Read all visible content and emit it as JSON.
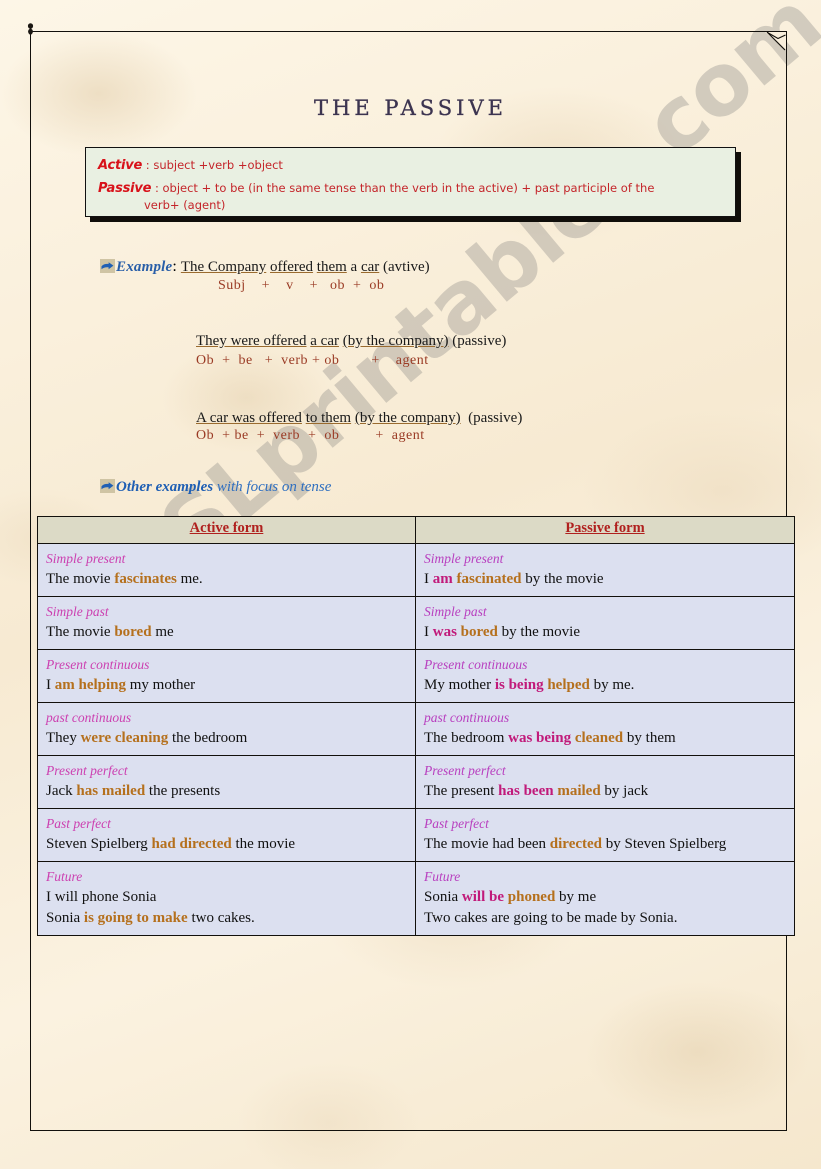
{
  "document": {
    "title": "THE  PASSIVE",
    "watermark": "ESLprintables.com"
  },
  "definition_box": {
    "active_key": "Active",
    "active_sep": " : ",
    "active_text": "subject +verb +object",
    "passive_key": "Passive",
    "passive_sep": " : ",
    "passive_text": "object + to be (in the same tense than the verb in the active) + past participle  of the",
    "passive_text_cont": "verb+ (agent)",
    "bg_color": "#e9f0e2",
    "text_color": "#c4252a",
    "key_color": "#d8121a"
  },
  "example_section": {
    "icon": "pointing-hand-icon",
    "label": "Example",
    "label_sep": ": ",
    "groups": [
      {
        "sentence": "The Company offered them a car (avtive)",
        "sentence_parts": [
          {
            "text": "The Company",
            "underline": true
          },
          {
            "text": " ",
            "underline": false
          },
          {
            "text": "offered",
            "underline": true
          },
          {
            "text": " ",
            "underline": false
          },
          {
            "text": "them",
            "underline": true
          },
          {
            "text": " a ",
            "underline": false
          },
          {
            "text": "car",
            "underline": true
          },
          {
            "text": " (avtive)",
            "underline": false
          }
        ],
        "parse": "Subj    +    v    +   ob  +  ob"
      },
      {
        "sentence": "They were offered a car (by the company) (passive)",
        "parse": "Ob  +  be   +  verb + ob        +    agent"
      },
      {
        "sentence": "A car was offered to them (by the company)   (passive)",
        "parse": "Ob  + be  +  verb  +  ob          +  agent"
      }
    ]
  },
  "other_examples_heading": {
    "icon": "pointing-hand-icon",
    "strong": "Other examples",
    "light": " with focus on tense"
  },
  "table": {
    "headers": [
      "Active form",
      "Passive form"
    ],
    "header_bg": "#dcdac6",
    "cell_bg": "#dce0f0",
    "rows": [
      {
        "active": {
          "tense": "Simple present",
          "parts": [
            {
              "t": "The movie ",
              "s": "plain"
            },
            {
              "t": "fascinates",
              "s": "brown"
            },
            {
              "t": " me.",
              "s": "plain"
            }
          ]
        },
        "passive": {
          "tense": "Simple present",
          "parts": [
            {
              "t": "I ",
              "s": "plain"
            },
            {
              "t": "am",
              "s": "mag"
            },
            {
              "t": " ",
              "s": "plain"
            },
            {
              "t": "fascinated",
              "s": "brown"
            },
            {
              "t": " by the movie",
              "s": "plain"
            }
          ]
        }
      },
      {
        "active": {
          "tense": "Simple past",
          "parts": [
            {
              "t": "The movie ",
              "s": "plain"
            },
            {
              "t": "bored",
              "s": "brown"
            },
            {
              "t": " me",
              "s": "plain"
            }
          ]
        },
        "passive": {
          "tense": "Simple past",
          "parts": [
            {
              "t": "I ",
              "s": "plain"
            },
            {
              "t": "was",
              "s": "mag"
            },
            {
              "t": " ",
              "s": "plain"
            },
            {
              "t": "bored",
              "s": "brown"
            },
            {
              "t": " by the movie",
              "s": "plain"
            }
          ]
        }
      },
      {
        "active": {
          "tense": "Present continuous",
          "parts": [
            {
              "t": "I ",
              "s": "plain"
            },
            {
              "t": "am helping",
              "s": "brown"
            },
            {
              "t": " my mother",
              "s": "plain"
            }
          ]
        },
        "passive": {
          "tense": "Present continuous",
          "parts": [
            {
              "t": "My mother ",
              "s": "plain"
            },
            {
              "t": "is being",
              "s": "mag"
            },
            {
              "t": " ",
              "s": "plain"
            },
            {
              "t": "helped",
              "s": "brown"
            },
            {
              "t": " by me.",
              "s": "plain"
            }
          ]
        }
      },
      {
        "active": {
          "tense": "past continuous",
          "parts": [
            {
              "t": "They ",
              "s": "plain"
            },
            {
              "t": "were cleaning",
              "s": "brown"
            },
            {
              "t": " the bedroom",
              "s": "plain"
            }
          ]
        },
        "passive": {
          "tense": "past continuous",
          "parts": [
            {
              "t": "The bedroom ",
              "s": "plain"
            },
            {
              "t": "was being",
              "s": "mag"
            },
            {
              "t": " ",
              "s": "plain"
            },
            {
              "t": "cleaned",
              "s": "brown"
            },
            {
              "t": " by them",
              "s": "plain"
            }
          ]
        }
      },
      {
        "active": {
          "tense": "Present perfect",
          "parts": [
            {
              "t": "Jack ",
              "s": "plain"
            },
            {
              "t": "has mailed",
              "s": "brown"
            },
            {
              "t": "  the presents",
              "s": "plain"
            }
          ]
        },
        "passive": {
          "tense": "Present perfect",
          "parts": [
            {
              "t": "The present ",
              "s": "plain"
            },
            {
              "t": "has been",
              "s": "mag"
            },
            {
              "t": " ",
              "s": "plain"
            },
            {
              "t": "mailed",
              "s": "brown"
            },
            {
              "t": " by jack",
              "s": "plain"
            }
          ]
        }
      },
      {
        "active": {
          "tense": "Past perfect",
          "parts": [
            {
              "t": "Steven Spielberg ",
              "s": "plain"
            },
            {
              "t": "had directed",
              "s": "brown"
            },
            {
              "t": " the movie",
              "s": "plain"
            }
          ]
        },
        "passive": {
          "tense": "Past perfect",
          "parts": [
            {
              "t": "The movie had been ",
              "s": "plain"
            },
            {
              "t": "directed",
              "s": "brown"
            },
            {
              "t": " by Steven Spielberg",
              "s": "plain"
            }
          ]
        }
      },
      {
        "active": {
          "tense": "Future",
          "parts": [
            {
              "t": "I will phone Sonia",
              "s": "plain"
            },
            {
              "t": "\n",
              "s": "br"
            },
            {
              "t": "Sonia ",
              "s": "plain"
            },
            {
              "t": "is going to make",
              "s": "brown"
            },
            {
              "t": " two cakes.",
              "s": "plain"
            }
          ]
        },
        "passive": {
          "tense": "Future",
          "parts": [
            {
              "t": "Sonia ",
              "s": "plain"
            },
            {
              "t": "will be",
              "s": "mag"
            },
            {
              "t": " ",
              "s": "plain"
            },
            {
              "t": "phoned",
              "s": "brown"
            },
            {
              "t": " by me",
              "s": "plain"
            },
            {
              "t": "\n",
              "s": "br"
            },
            {
              "t": "Two cakes are going to be made by Sonia.",
              "s": "plain"
            }
          ]
        }
      }
    ]
  },
  "colors": {
    "page_bg": "#f8eedb",
    "title": "#3c3450",
    "heading_blue": "#2a5fa8",
    "verb_brown": "#b5701d",
    "aux_magenta": "#c11a7a",
    "tense_magenta": "#cc3fb0",
    "header_red": "#b0201e"
  }
}
